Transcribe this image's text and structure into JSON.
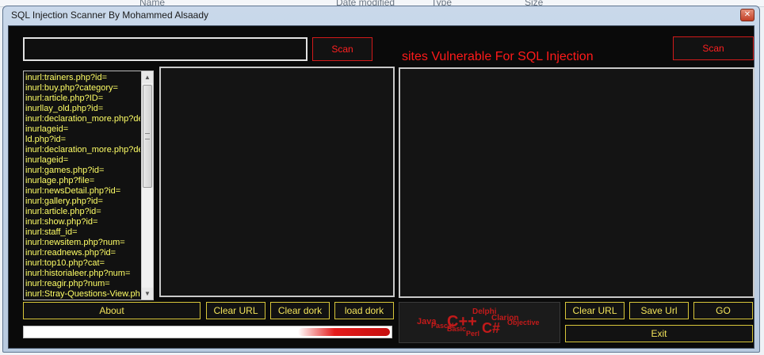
{
  "window": {
    "title": "SQL Injection Scanner By Mohammed Alsaady",
    "close_glyph": "✕"
  },
  "background_explorer": {
    "columns": [
      "Name",
      "Date modified",
      "Type",
      "Size"
    ]
  },
  "top": {
    "scan_left_label": "Scan",
    "scan_right_label": "Scan",
    "vulnerable_heading": "sites Vulnerable For SQL Injection"
  },
  "dork_list": {
    "items": [
      "inurl:trainers.php?id=",
      "inurl:buy.php?category=",
      "inurl:article.php?ID=",
      "inurllay_old.php?id=",
      "inurl:declaration_more.php?de",
      "inurlageid=",
      "ld.php?id=",
      "inurl:declaration_more.php?de",
      "inurlageid=",
      "inurl:games.php?id=",
      "inurlage.php?file=",
      "inurl:newsDetail.php?id=",
      "inurl:gallery.php?id=",
      "inurl:article.php?id=",
      "inurl:show.php?id=",
      "inurl:staff_id=",
      "inurl:newsitem.php?num=",
      "inurl:readnews.php?id=",
      "inurl:top10.php?cat=",
      "inurl:historialeer.php?num=",
      "inurl:reagir.php?num=",
      "inurl:Stray-Questions-View.php"
    ],
    "scroll_up": "▲",
    "scroll_down": "▼"
  },
  "buttons": {
    "about": "About",
    "clear_url_left": "Clear URL",
    "clear_dork": "Clear dork",
    "load_dork": "load dork",
    "clear_url_right": "Clear URL",
    "save_url": "Save Url",
    "go": "GO",
    "exit": "Exit"
  },
  "progress": {
    "value_percent": 25
  },
  "logo_cloud": {
    "words": [
      "Delphi",
      "Java",
      "C++",
      "Clarion",
      "Basic",
      "C#",
      "Perl",
      "Objective",
      "Pascal"
    ]
  },
  "colors": {
    "accent_red": "#ff1a1a",
    "accent_yellow": "#f2e35a",
    "panel_bg": "#141414"
  }
}
